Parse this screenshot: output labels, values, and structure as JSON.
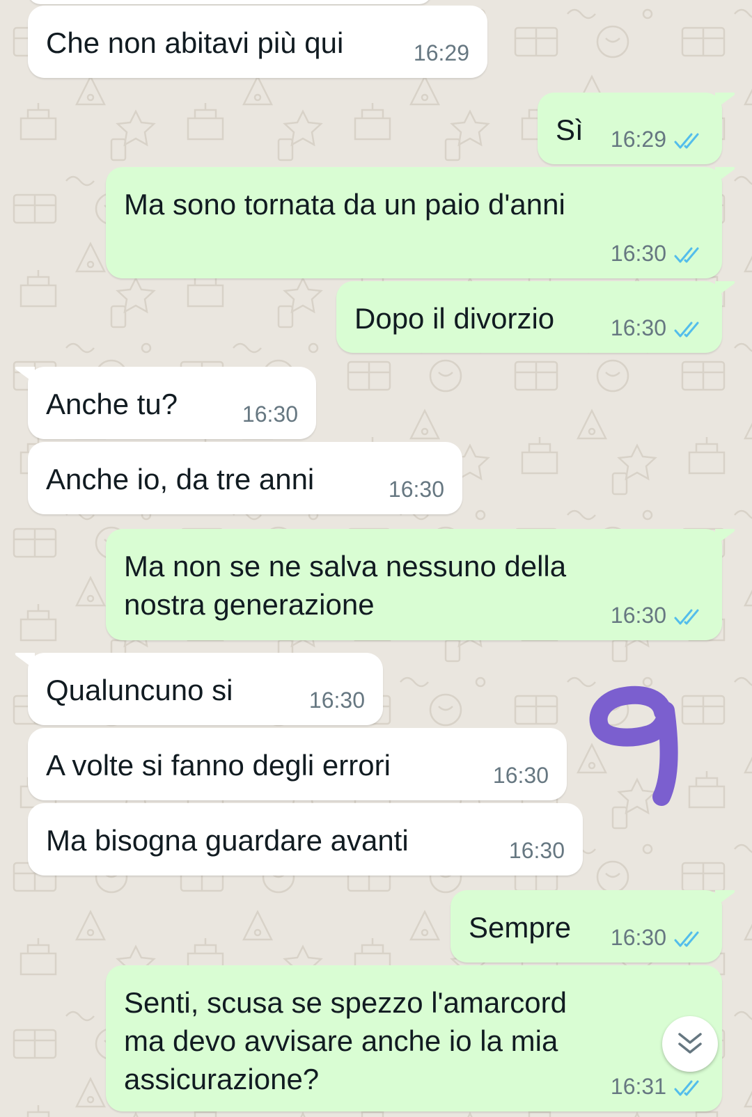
{
  "theme": {
    "background": "#eae6df",
    "incoming_bubble": "#ffffff",
    "outgoing_bubble": "#d9fdd3",
    "read_ticks": "#53bdeb",
    "annotation_color": "#7b5fcf"
  },
  "messages": [
    {
      "dir": "in",
      "text": "Che non abitavi più qui",
      "time": "16:29"
    },
    {
      "dir": "out",
      "text": "Sì",
      "time": "16:29",
      "status": "read"
    },
    {
      "dir": "out",
      "text": "Ma sono tornata da un paio d'anni",
      "time": "16:30",
      "status": "read"
    },
    {
      "dir": "out",
      "text": "Dopo il divorzio",
      "time": "16:30",
      "status": "read"
    },
    {
      "dir": "in",
      "text": "Anche tu?",
      "time": "16:30"
    },
    {
      "dir": "in",
      "text": "Anche io, da tre anni",
      "time": "16:30"
    },
    {
      "dir": "out",
      "text": "Ma non se ne salva nessuno della\nnostra generazione",
      "time": "16:30",
      "status": "read"
    },
    {
      "dir": "in",
      "text": "Qualuncuno si",
      "time": "16:30"
    },
    {
      "dir": "in",
      "text": "A volte si fanno degli errori",
      "time": "16:30"
    },
    {
      "dir": "in",
      "text": "Ma bisogna guardare avanti",
      "time": "16:30"
    },
    {
      "dir": "out",
      "text": "Sempre",
      "time": "16:30",
      "status": "read"
    },
    {
      "dir": "out",
      "text": "Senti, scusa se spezzo l'amarcord\nma devo avvisare anche io la mia\nassicurazione?",
      "time": "16:31",
      "status": "read"
    }
  ],
  "annotation": {
    "glyph": "9"
  },
  "scroll_down_button": {
    "icon": "double-chevron-down-icon"
  }
}
